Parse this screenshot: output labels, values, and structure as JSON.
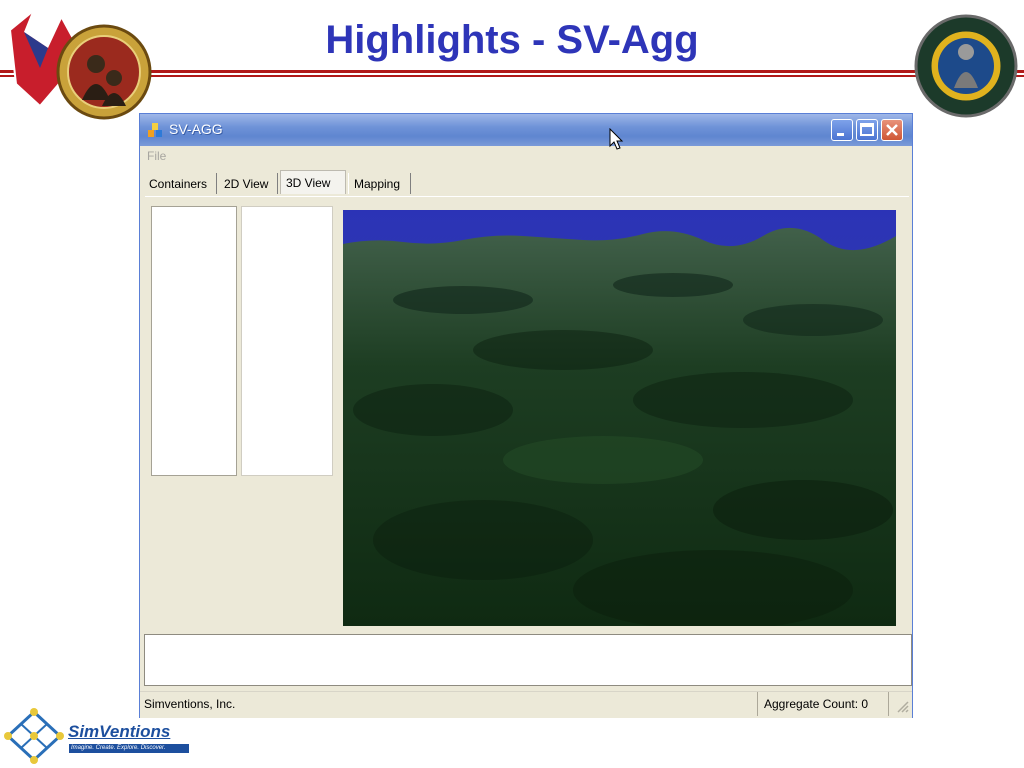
{
  "slide": {
    "title": "Highlights - SV-Agg",
    "logos": {
      "left": "army-rdecom-seal",
      "right": "simulation-training-seal",
      "bottom_company": "SimVentions",
      "bottom_tagline": "Imagine. Create. Explore. Discover."
    },
    "colors": {
      "title": "#2e35b8",
      "header_rule": "#b01818"
    }
  },
  "window": {
    "title": "SV-AGG",
    "menu": {
      "file": "File"
    },
    "tabs": [
      {
        "label": "Containers",
        "active": false
      },
      {
        "label": "2D View",
        "active": false
      },
      {
        "label": "3D View",
        "active": true
      },
      {
        "label": "Mapping",
        "active": false
      }
    ],
    "viewport": {
      "content": "3d-terrain",
      "sky_color": "#2b33b0",
      "terrain_color": "#1e4a20"
    },
    "status": {
      "left": "Simventions, Inc.",
      "right": "Aggregate Count: 0"
    }
  }
}
